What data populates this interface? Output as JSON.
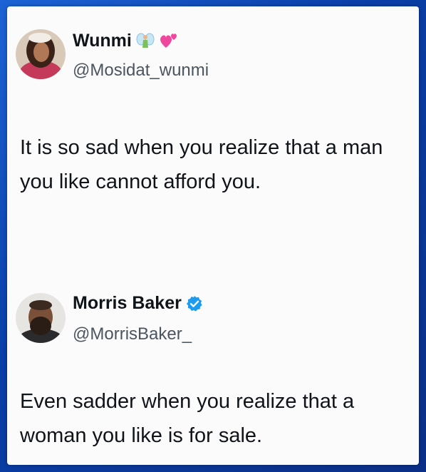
{
  "tweets": [
    {
      "name": "Wunmi",
      "name_emojis": [
        "fairy-icon",
        "two-hearts-icon"
      ],
      "handle": "@Mosidat_wunmi",
      "verified": false,
      "text": "It is so sad when you realize that a man you like cannot afford you."
    },
    {
      "name": "Morris Baker",
      "verified": true,
      "handle": "@MorrisBaker_",
      "text": "Even sadder when you realize that a woman you like is for sale."
    }
  ],
  "colors": {
    "background": "#0b3fa8",
    "card": "#fbfbfc",
    "verified_badge": "#1d9bf0",
    "handle_text": "#4b5560"
  }
}
